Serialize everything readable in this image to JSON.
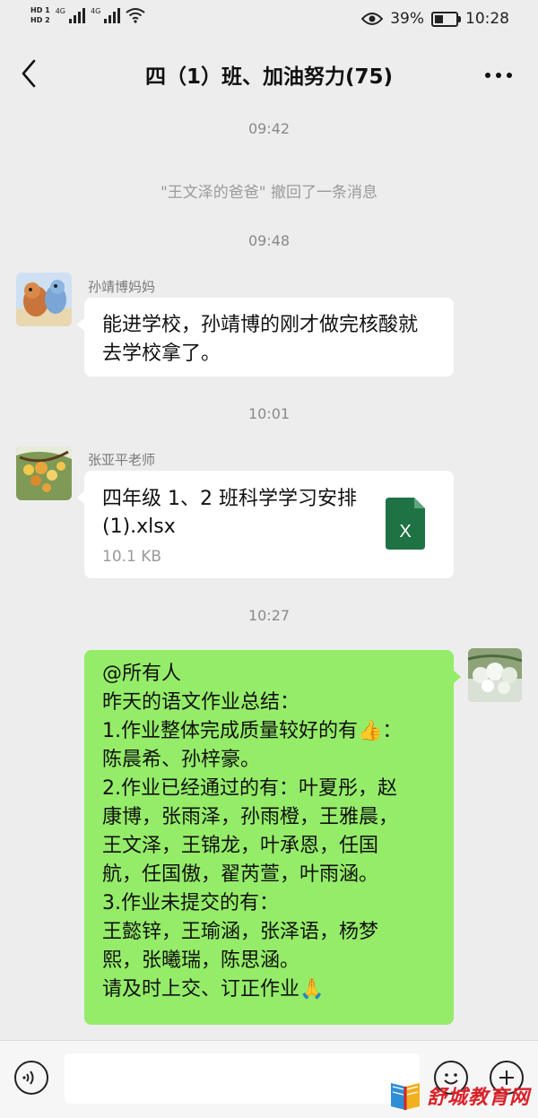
{
  "status_bar": {
    "hd1": "HD 1",
    "hd2": "HD 2",
    "net1": "4G",
    "net2": "4G",
    "battery_percent": "39%",
    "battery_level": 0.39,
    "time": "10:28",
    "icons": [
      "eye-icon",
      "wifi-icon",
      "battery-icon"
    ]
  },
  "header": {
    "back_icon": "chevron-left-icon",
    "title": "四（1）班、加油努力(75)",
    "more_icon": "more-dots-icon"
  },
  "chat": {
    "timestamps": [
      "09:42",
      "09:48",
      "10:01",
      "10:27"
    ],
    "system_message": "\"王文泽的爸爸\" 撤回了一条消息",
    "messages": [
      {
        "sender": "孙靖博妈妈",
        "text": "能进学校，孙靖博的刚才做完核酸就去学校拿了。"
      },
      {
        "sender": "张亚平老师",
        "file_name": "四年级 1、2 班科学学习安排(1).xlsx",
        "file_size": "10.1 KB",
        "file_icon": "excel-file-icon",
        "file_icon_letter": "X"
      },
      {
        "lines": [
          "@所有人",
          "昨天的语文作业总结：",
          "1.作业整体完成质量较好的有👍：",
          "陈晨希、孙梓豪。",
          "2.作业已经通过的有：叶夏彤，赵",
          "康博，张雨泽，孙雨橙，王雅晨，",
          "王文泽，王锦龙，叶承恩，任国",
          "航，任国傲，翟芮萱，叶雨涵。",
          "3.作业未提交的有：",
          "王懿锌，王瑜涵，张泽语，杨梦",
          "熙，张曦瑞，陈思涵。",
          "请及时上交、订正作业🙏"
        ]
      }
    ]
  },
  "input_bar": {
    "icons": [
      "voice-icon",
      "emoji-icon",
      "plus-icon"
    ]
  },
  "watermark": {
    "text": "舒城教育网"
  },
  "colors": {
    "background": "#ededed",
    "bubble_green": "#95ec69",
    "excel_green": "#1f7244",
    "watermark_red": "#d9222a"
  }
}
